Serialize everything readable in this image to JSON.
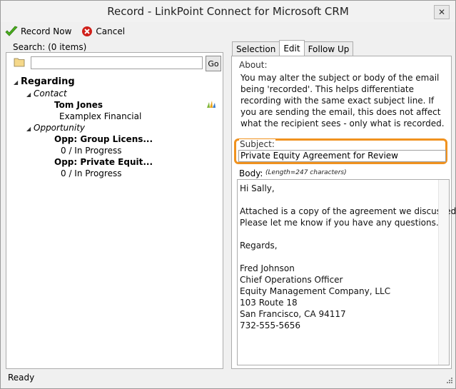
{
  "window": {
    "title": "Record - LinkPoint Connect for Microsoft CRM",
    "close_glyph": "✕"
  },
  "toolbar": {
    "record_now": "Record Now",
    "cancel": "Cancel"
  },
  "search": {
    "label": "Search: (0 items)",
    "value": "",
    "go": "Go"
  },
  "tree": {
    "root": "Regarding",
    "contact_group": "Contact",
    "contact_name": "Tom Jones",
    "contact_company": "Examplex Financial",
    "opportunity_group": "Opportunity",
    "opp1_name": "Opp: Group Licens...",
    "opp1_status": "0 / In Progress",
    "opp2_name": "Opp: Private Equit...",
    "opp2_status": "0 / In Progress"
  },
  "tabs": [
    {
      "label": "Selection",
      "active": false
    },
    {
      "label": "Edit",
      "active": true
    },
    {
      "label": "Follow Up",
      "active": false
    }
  ],
  "edit": {
    "about_label": "About:",
    "about_text": "You may alter the subject or body of the email being 'recorded'.  This helps differentiate recording with the same exact subject line.  If you are sending the email, this does not affect what the recipient sees - only what is recorded.",
    "subject_label": "Subject:",
    "subject_value": "Private Equity Agreement for Review",
    "body_label": "Body:",
    "body_length": "(Length=247 characters)",
    "body_value": "Hi Sally,\n\nAttached is a copy of the agreement we discussed.\nPlease let me know if you have any questions.\n\nRegards,\n\nFred Johnson\nChief Operations Officer\nEquity Management Company, LLC\n103 Route 18\nSan Francisco, CA 94117\n732-555-5656"
  },
  "status": {
    "text": "Ready"
  },
  "colors": {
    "highlight": "#f0921f",
    "record_check": "#4caf1e",
    "cancel_red": "#d0201a"
  },
  "icons": [
    "check-icon",
    "cancel-icon",
    "folder-icon",
    "crm-logo-icon",
    "collapse-arrow-icon",
    "resize-grip-icon"
  ]
}
